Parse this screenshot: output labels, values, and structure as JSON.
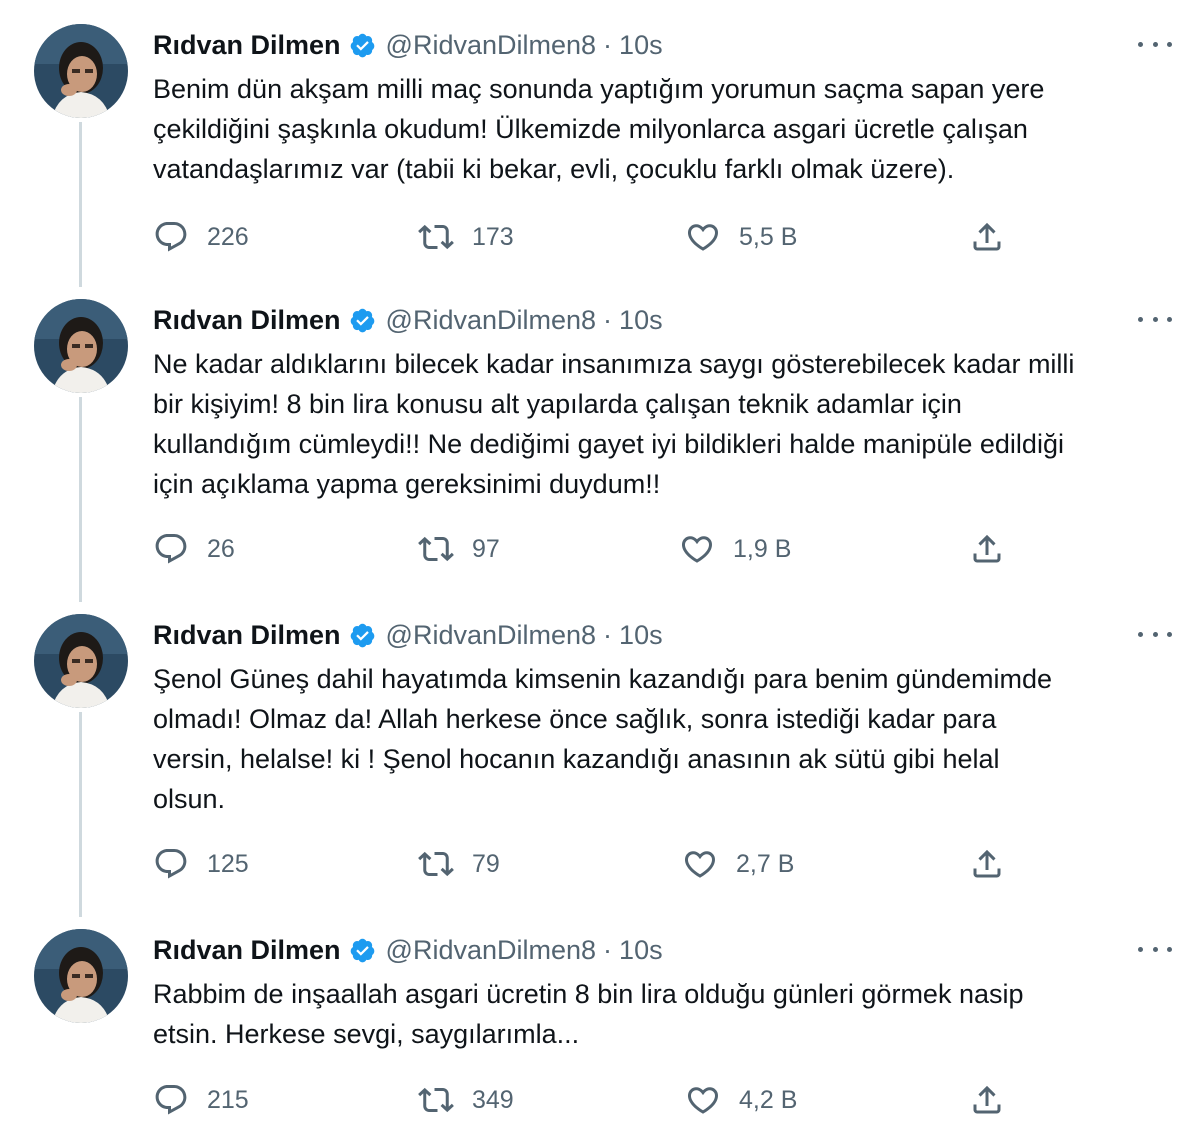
{
  "author": {
    "name": "Rıdvan Dilmen",
    "handle": "@RidvanDilmen8",
    "separator": "·",
    "time": "10s"
  },
  "icons": {
    "verified": "verified-badge-icon",
    "reply": "reply-icon",
    "retweet": "retweet-icon",
    "like": "like-icon",
    "share": "share-icon",
    "more": "more-options-icon"
  },
  "colors": {
    "verified": "#1d9bf0",
    "muted": "#536471",
    "thread_line": "#cfd9de"
  },
  "tweets": [
    {
      "text": "Benim dün akşam milli maç sonunda yaptığım yorumun saçma sapan yere\nçekildiğini şaşkınla okudum! Ülkemizde milyonlarca asgari ücretle çalışan\nvatandaşlarımız var (tabii ki bekar, evli, çocuklu farklı olmak üzere).",
      "replies": "226",
      "retweets": "173",
      "likes": "5,5 B"
    },
    {
      "text": "Ne kadar aldıklarını bilecek kadar insanımıza saygı gösterebilecek kadar milli\nbir kişiyim! 8 bin lira konusu alt yapılarda çalışan teknik adamlar için\nkullandığım cümleydi!! Ne dediğimi gayet iyi bildikleri halde manipüle edildiği\niçin açıklama yapma gereksinimi duydum!!",
      "replies": "26",
      "retweets": "97",
      "likes": "1,9 B"
    },
    {
      "text": "Şenol Güneş dahil hayatımda kimsenin kazandığı para benim gündemimde\nolmadı! Olmaz da! Allah herkese önce sağlık, sonra istediği kadar para\nversin, helalse! ki ! Şenol hocanın kazandığı anasının ak sütü gibi helal\nolsun.",
      "replies": "125",
      "retweets": "79",
      "likes": "2,7 B"
    },
    {
      "text": "Rabbim de inşaallah asgari ücretin 8 bin lira olduğu günleri görmek nasip\netsin. Herkese sevgi, saygılarımla...",
      "replies": "215",
      "retweets": "349",
      "likes": "4,2 B"
    }
  ]
}
